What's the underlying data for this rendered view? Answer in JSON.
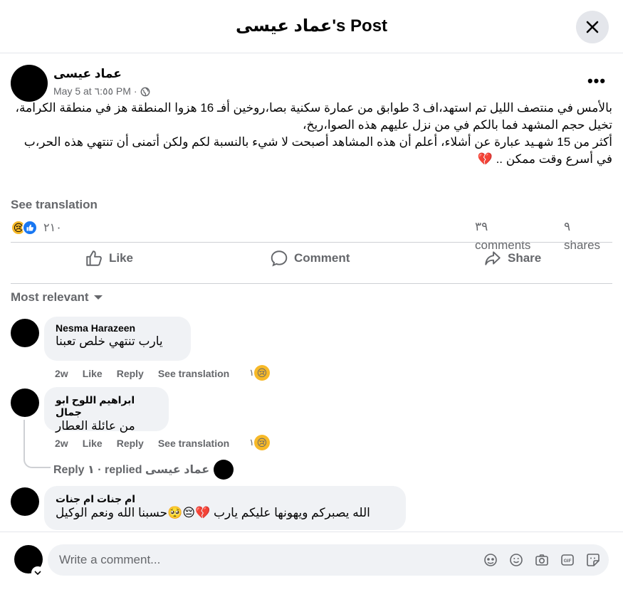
{
  "header": {
    "title": "عماد عيسى's Post"
  },
  "post": {
    "author": "عماد عيسى",
    "meta": "May 5 at ٦:٥٥ PM · ",
    "body": [
      "بالأمس في منتصف الليل تم استهد،اف 3 طوابق من عمارة سكنية بصا،روخين أفـ 16 هزوا المنطقة هز في منطقة الكرامة،",
      "تخيل حجم المشهد فما بالكم في من نزل عليهم هذه الصوا،ريخ،",
      "أكثر من 15 شهـيد عبارة عن أشلاء، أعلم أن هذه المشاهد أصبحت لا شيء بالنسبة لكم ولكن أتمنى أن تنتهي هذه الحر،ب في أسرع وقت ممكن .. 💔"
    ],
    "see_translation": "See translation",
    "reactions_count": "٢١٠",
    "comments_count": "٣٩",
    "comments_label": "comments",
    "shares_count": "٩",
    "shares_label": "shares"
  },
  "actions": {
    "like": "Like",
    "comment": "Comment",
    "share": "Share"
  },
  "sort_label": "Most relevant",
  "comments": [
    {
      "name": "Nesma Harazeen",
      "text": "يارب تنتهي خلص تعبنا",
      "time": "2w",
      "like": "Like",
      "reply": "Reply",
      "translate": "See translation",
      "react_count": "١"
    },
    {
      "name": "ابراهيم اللوح ابو جمال",
      "text": "من عائلة العطار",
      "time": "2w",
      "like": "Like",
      "reply": "Reply",
      "translate": "See translation",
      "react_count": "١"
    },
    {
      "name": "ام جنات ام جنات",
      "text": "الله يصبركم ويهونها عليكم يارب 💔😔🥺حسبنا الله ونعم الوكيل"
    }
  ],
  "replies_text": "عماد عيسى replied · ١ Reply",
  "composer": {
    "placeholder": "Write a comment..."
  },
  "colors": {
    "accent": "#1877f2",
    "secondary_text": "#65676b",
    "bubble": "#f0f2f5"
  }
}
